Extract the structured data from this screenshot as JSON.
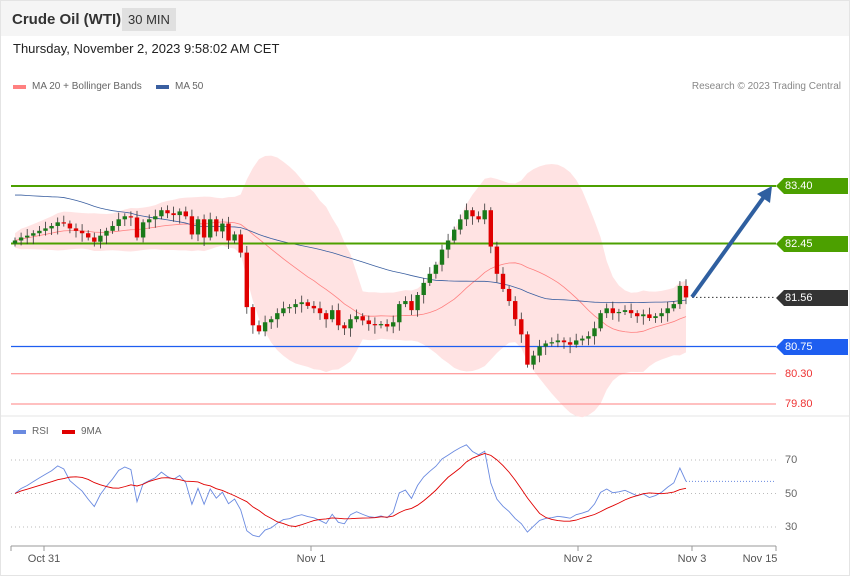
{
  "header": {
    "title": "Crude Oil (WTI)",
    "timeframe": "30 MIN",
    "datetime": "Thursday, November 2, 2023 9:58:02 AM CET"
  },
  "legend": {
    "ma20": "MA 20 + Bollinger Bands",
    "ma50": "MA 50",
    "rsi": "RSI",
    "ma9": "9MA"
  },
  "credit": "Research © 2023 Trading Central",
  "colors": {
    "up": "#1a7a1a",
    "down": "#e00000",
    "resistance": "#4ca000",
    "support": "#1e5ef0",
    "current": "#333333",
    "ma20": "#ff8080",
    "ma50": "#3a5fa0",
    "rsi": "#6a8ae0",
    "rsi_ma": "#e00000"
  },
  "chart_data": {
    "type": "candlestick",
    "levels": {
      "resistance": [
        "83.40",
        "82.45"
      ],
      "current": "81.56",
      "pivot": "80.75",
      "support": [
        "80.30",
        "79.80"
      ]
    },
    "ylim": [
      79.5,
      84.3
    ],
    "closes": [
      82.5,
      82.55,
      82.58,
      82.62,
      82.66,
      82.7,
      82.74,
      82.8,
      82.78,
      82.7,
      82.66,
      82.62,
      82.55,
      82.48,
      82.58,
      82.66,
      82.74,
      82.85,
      82.9,
      82.88,
      82.55,
      82.8,
      82.85,
      82.9,
      83.0,
      82.95,
      82.92,
      82.98,
      82.9,
      82.6,
      82.85,
      82.55,
      82.85,
      82.65,
      82.78,
      82.5,
      82.6,
      82.3,
      81.4,
      81.1,
      81.0,
      81.15,
      81.2,
      81.3,
      81.38,
      81.4,
      81.45,
      81.48,
      81.42,
      81.38,
      81.3,
      81.2,
      81.35,
      81.1,
      81.05,
      81.2,
      81.25,
      81.18,
      81.12,
      81.1,
      81.12,
      81.08,
      81.15,
      81.45,
      81.5,
      81.35,
      81.6,
      81.8,
      81.95,
      82.1,
      82.35,
      82.5,
      82.68,
      82.85,
      83.0,
      82.9,
      82.85,
      83.0,
      82.4,
      81.95,
      81.7,
      81.5,
      81.2,
      80.95,
      80.45,
      80.6,
      80.75,
      80.8,
      80.82,
      80.85,
      80.82,
      80.78,
      80.85,
      80.88,
      80.92,
      81.05,
      81.3,
      81.38,
      81.3,
      81.32,
      81.35,
      81.3,
      81.25,
      81.28,
      81.22,
      81.25,
      81.3,
      81.38,
      81.45,
      81.75,
      81.56
    ],
    "rsi_ticks": [
      "70",
      "50",
      "30"
    ],
    "x_ticks": [
      "Oct 31",
      "Nov 1",
      "Nov 2",
      "Nov 3",
      "Nov 15"
    ]
  }
}
